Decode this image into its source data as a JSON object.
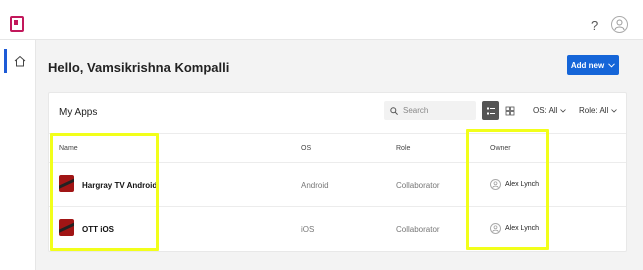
{
  "header": {
    "help_label": "?"
  },
  "main": {
    "greeting": "Hello, Vamsikrishna Kompalli",
    "add_button_label": "Add new"
  },
  "apps": {
    "title": "My Apps",
    "search_placeholder": "Search",
    "filters": {
      "os": "OS: All",
      "role": "Role: All"
    },
    "columns": {
      "name": "Name",
      "os": "OS",
      "role": "Role",
      "owner": "Owner"
    },
    "rows": [
      {
        "name": "Hargray TV Android",
        "os": "Android",
        "role": "Collaborator",
        "owner": "Alex Lynch"
      },
      {
        "name": "OTT iOS",
        "os": "iOS",
        "role": "Collaborator",
        "owner": "Alex Lynch"
      }
    ]
  },
  "colors": {
    "accent": "#1565d8",
    "highlight": "#f2ff1a",
    "app_icon": "#a11515",
    "brand": "#c2185b"
  }
}
